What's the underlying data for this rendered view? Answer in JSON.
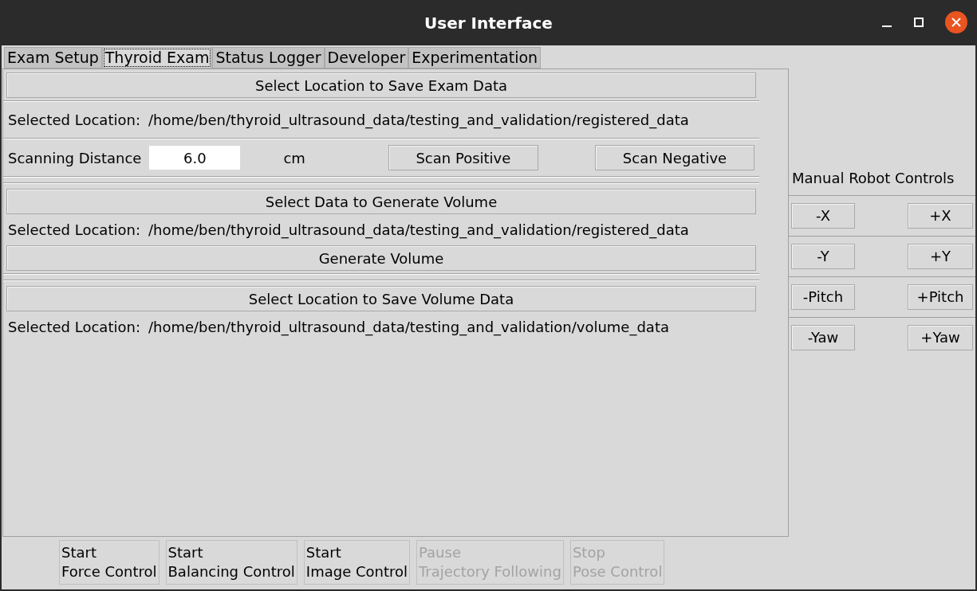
{
  "window": {
    "title": "User Interface"
  },
  "tabs": [
    {
      "label": "Exam Setup",
      "selected": false
    },
    {
      "label": "Thyroid Exam",
      "selected": true
    },
    {
      "label": "Status Logger",
      "selected": false
    },
    {
      "label": "Developer",
      "selected": false
    },
    {
      "label": "Experimentation",
      "selected": false
    }
  ],
  "exam_data": {
    "select_button": "Select Location to Save Exam Data",
    "location_label": "Selected Location:",
    "location_path": "/home/ben/thyroid_ultrasound_data/testing_and_validation/registered_data",
    "distance_label": "Scanning Distance",
    "distance_value": "6.0",
    "distance_unit": "cm",
    "scan_positive": "Scan Positive",
    "scan_negative": "Scan Negative"
  },
  "volume": {
    "select_button": "Select Data to Generate Volume",
    "location_label": "Selected Location:",
    "location_path": "/home/ben/thyroid_ultrasound_data/testing_and_validation/registered_data",
    "generate_button": "Generate Volume"
  },
  "volume_save": {
    "select_button": "Select Location to Save Volume Data",
    "location_label": "Selected Location:",
    "location_path": "/home/ben/thyroid_ultrasound_data/testing_and_validation/volume_data"
  },
  "robot_controls": {
    "title": "Manual Robot Controls",
    "rows": [
      {
        "minus": "-X",
        "plus": "+X"
      },
      {
        "minus": "-Y",
        "plus": "+Y"
      },
      {
        "minus": "-Pitch",
        "plus": "+Pitch"
      },
      {
        "minus": "-Yaw",
        "plus": "+Yaw"
      }
    ]
  },
  "bottom_buttons": [
    {
      "lines": [
        "Start",
        "Force Control"
      ],
      "disabled": false
    },
    {
      "lines": [
        "Start",
        "Balancing Control"
      ],
      "disabled": false
    },
    {
      "lines": [
        "Start",
        "Image Control"
      ],
      "disabled": false
    },
    {
      "lines": [
        "Pause",
        "Trajectory Following"
      ],
      "disabled": true
    },
    {
      "lines": [
        "Stop",
        "Pose Control"
      ],
      "disabled": true
    }
  ]
}
